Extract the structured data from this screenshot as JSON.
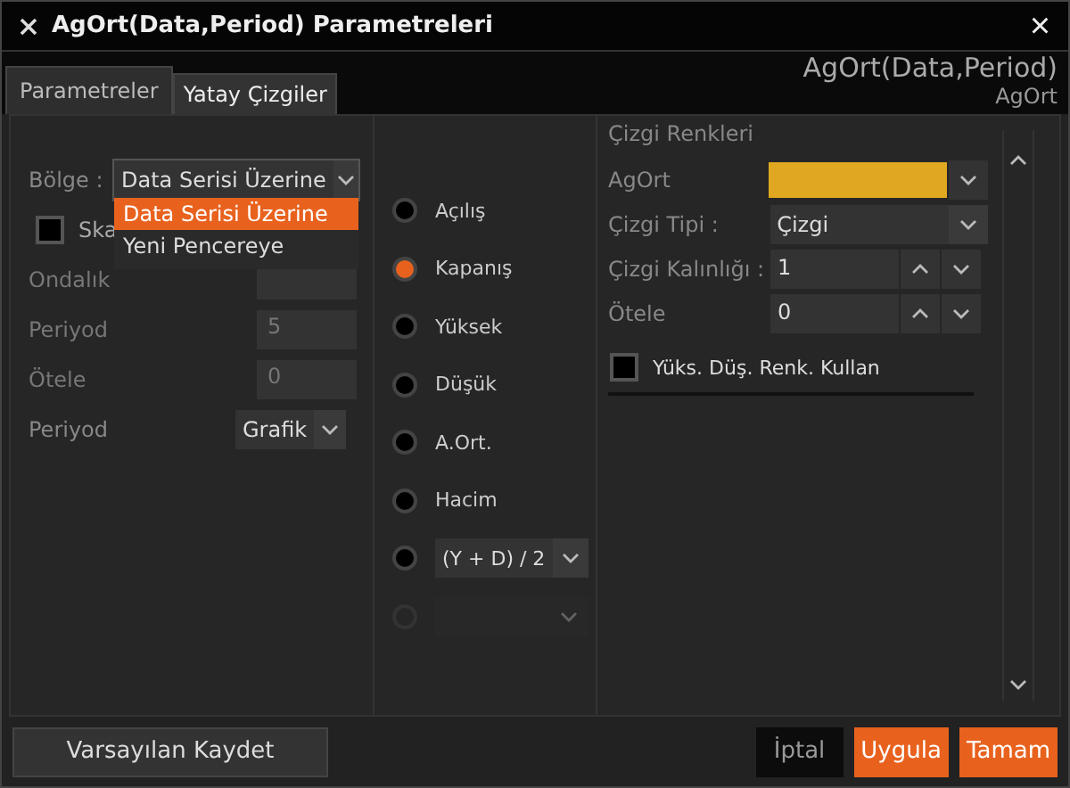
{
  "window": {
    "title": "AgOrt(Data,Period) Parametreleri",
    "close": "×"
  },
  "tabs": [
    {
      "label": "Parametreler",
      "selected": true
    },
    {
      "label": "Yatay Çizgiler",
      "selected": false
    }
  ],
  "header": {
    "title": "AgOrt(Data,Period)",
    "subtitle": "AgOrt"
  },
  "left": {
    "region": {
      "label": "Bölge :",
      "value": "Data Serisi Üzerine",
      "expanded": true,
      "options": [
        {
          "label": "Data Serisi Üzerine",
          "selected": true
        },
        {
          "label": "Yeni Pencereye",
          "selected": false
        }
      ]
    },
    "scale": {
      "label": "Ska",
      "checked": false
    },
    "rows": [
      {
        "kind": "field",
        "label": "Ondalık",
        "disabled": true
      },
      {
        "kind": "field",
        "label": "Periyod",
        "value": "5",
        "disabled": true
      },
      {
        "kind": "field",
        "label": "Ötele",
        "value": "0",
        "disabled": true
      },
      {
        "kind": "select",
        "label": "Periyod",
        "value": "Grafik",
        "disabled": false
      }
    ]
  },
  "sources": [
    {
      "kind": "radio",
      "label": "Açılış",
      "selected": false,
      "disabled": false
    },
    {
      "kind": "radio",
      "label": "Kapanış",
      "selected": true,
      "disabled": false
    },
    {
      "kind": "radio",
      "label": "Yüksek",
      "selected": false,
      "disabled": false
    },
    {
      "kind": "radio",
      "label": "Düşük",
      "selected": false,
      "disabled": false
    },
    {
      "kind": "radio",
      "label": "A.Ort.",
      "selected": false,
      "disabled": false
    },
    {
      "kind": "radio",
      "label": "Hacim",
      "selected": false,
      "disabled": false
    },
    {
      "kind": "select",
      "value": "(Y + D) / 2",
      "selected": false,
      "disabled": false
    },
    {
      "kind": "select",
      "selected": false,
      "disabled": true
    }
  ],
  "right": {
    "title": "Çizgi Renkleri",
    "color_row": {
      "label": "AgOrt",
      "color": "#e0a820"
    },
    "line_type": {
      "label": "Çizgi Tipi :",
      "value": "Çizgi"
    },
    "spinners": [
      {
        "label": "Çizgi Kalınlığı :",
        "value": "1"
      },
      {
        "label": "Ötele",
        "value": "0"
      }
    ],
    "checkbox": {
      "label": "Yüks. Düş. Renk. Kullan",
      "checked": false
    }
  },
  "footer": {
    "save_default": "Varsayılan Kaydet",
    "buttons": [
      {
        "kind": "plain",
        "label": "İptal"
      },
      {
        "kind": "accent",
        "label": "Uygula"
      },
      {
        "kind": "accent",
        "label": "Tamam"
      }
    ]
  }
}
